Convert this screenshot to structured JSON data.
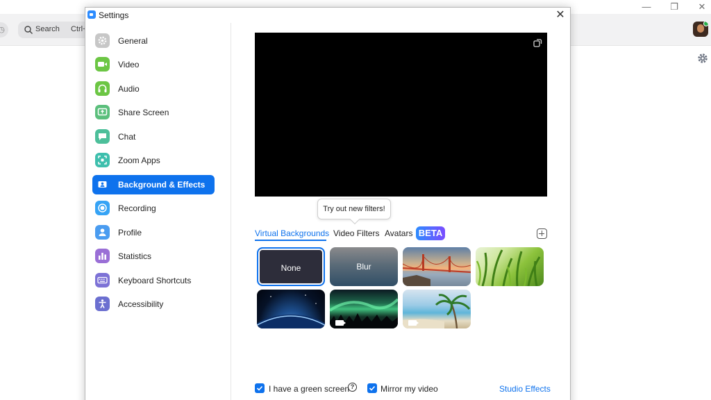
{
  "background_app": {
    "search_label": "Search",
    "search_shortcut": "Ctrl+",
    "window_controls": [
      "—",
      "❐",
      "✕"
    ]
  },
  "dialog": {
    "title": "Settings",
    "close_glyph": "✕"
  },
  "sidebar": {
    "items": [
      {
        "label": "General",
        "icon": "gear-icon",
        "color": "#c7c7c7"
      },
      {
        "label": "Video",
        "icon": "video-camera-icon",
        "color": "#6cc644"
      },
      {
        "label": "Audio",
        "icon": "headphones-icon",
        "color": "#6cc644"
      },
      {
        "label": "Share Screen",
        "icon": "share-screen-icon",
        "color": "#5bbf7c"
      },
      {
        "label": "Chat",
        "icon": "chat-bubble-icon",
        "color": "#4cbf9a"
      },
      {
        "label": "Zoom Apps",
        "icon": "zoom-apps-icon",
        "color": "#3ebfad"
      },
      {
        "label": "Background & Effects",
        "icon": "background-icon",
        "color": "#0e72ed",
        "active": true
      },
      {
        "label": "Recording",
        "icon": "record-icon",
        "color": "#36a3f5"
      },
      {
        "label": "Profile",
        "icon": "profile-icon",
        "color": "#4a9cf0"
      },
      {
        "label": "Statistics",
        "icon": "statistics-icon",
        "color": "#9a6fd6"
      },
      {
        "label": "Keyboard Shortcuts",
        "icon": "keyboard-icon",
        "color": "#7d72d6"
      },
      {
        "label": "Accessibility",
        "icon": "accessibility-icon",
        "color": "#6b6fd0"
      }
    ]
  },
  "main": {
    "tooltip": "Try out new filters!",
    "tabs": {
      "virtual_backgrounds": "Virtual Backgrounds",
      "video_filters": "Video Filters",
      "avatars": "Avatars",
      "beta_badge": "BETA"
    },
    "backgrounds": [
      {
        "label": "None",
        "selected": true
      },
      {
        "label": "Blur"
      },
      {
        "label": "",
        "description_icon": "golden-gate-image"
      },
      {
        "label": "",
        "description_icon": "grass-image"
      },
      {
        "label": "",
        "description_icon": "earth-image"
      },
      {
        "label": "",
        "description_icon": "aurora-image",
        "video": true
      },
      {
        "label": "",
        "description_icon": "beach-image",
        "video": true
      }
    ],
    "footer": {
      "green_screen_label": "I have a green screen",
      "green_screen_checked": true,
      "mirror_label": "Mirror my video",
      "mirror_checked": true,
      "studio_effects_link": "Studio Effects"
    }
  },
  "colors": {
    "accent": "#0e72ed",
    "preview": "#000000"
  }
}
